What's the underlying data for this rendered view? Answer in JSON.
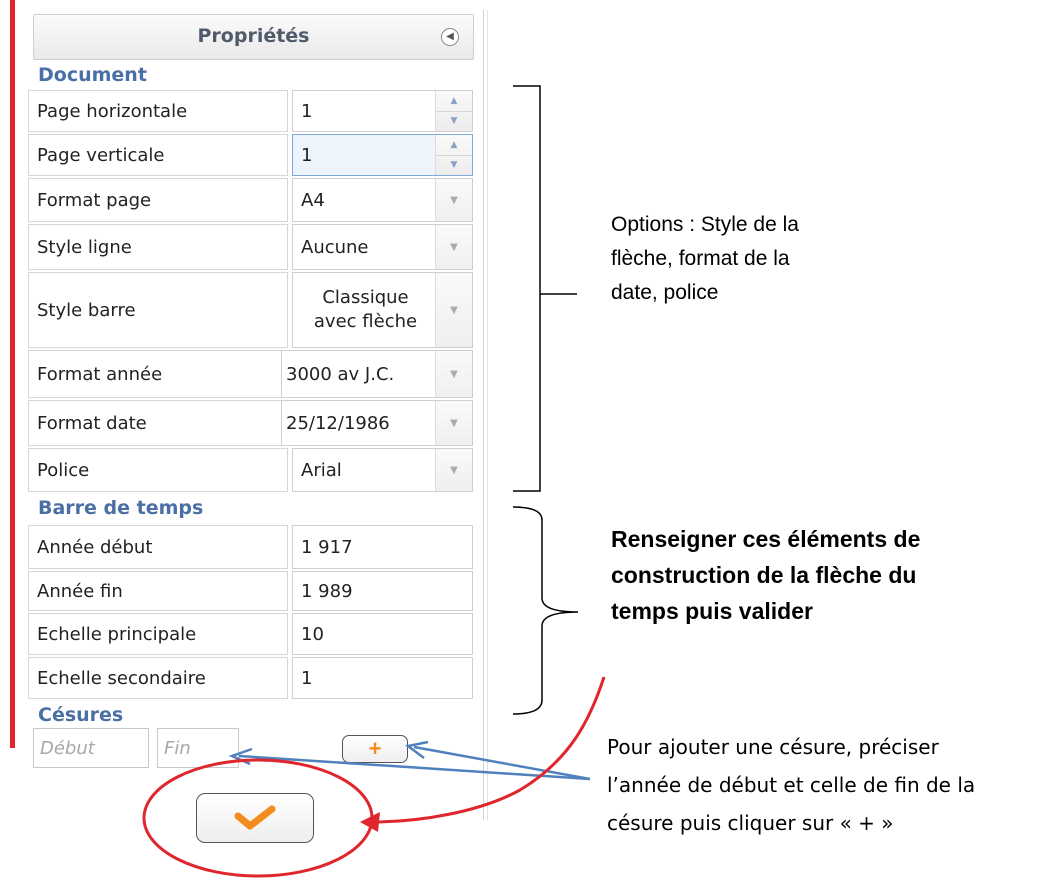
{
  "panel": {
    "title": "Propriétés",
    "collapse_icon": "circle-left-arrow-icon"
  },
  "document": {
    "title": "Document",
    "rows": [
      {
        "label": "Page horizontale",
        "value": "1",
        "control": "spinner"
      },
      {
        "label": "Page verticale",
        "value": "1",
        "control": "spinner"
      },
      {
        "label": "Format page",
        "value": "A4",
        "control": "dropdown"
      },
      {
        "label": "Style ligne",
        "value": "Aucune",
        "control": "dropdown"
      },
      {
        "label": "Style barre",
        "value": "Classique avec flèche",
        "value_line1": "Classique",
        "value_line2": "avec flèche",
        "control": "dropdown"
      },
      {
        "label": "Format année",
        "value": "3000 av J.C.",
        "control": "dropdown"
      },
      {
        "label": "Format date",
        "value": "25/12/1986",
        "control": "dropdown"
      },
      {
        "label": "Police",
        "value": "Arial",
        "control": "dropdown"
      }
    ]
  },
  "barre_de_temps": {
    "title": "Barre de temps",
    "rows": [
      {
        "label": "Année début",
        "value": "1 917"
      },
      {
        "label": "Année fin",
        "value": "1 989"
      },
      {
        "label": "Echelle principale",
        "value": "10"
      },
      {
        "label": "Echelle secondaire",
        "value": "1"
      }
    ]
  },
  "cesures": {
    "title": "Césures",
    "debut_placeholder": "Début",
    "fin_placeholder": "Fin",
    "add_button": "+"
  },
  "validate_button_icon": "checkmark-icon",
  "annotations": {
    "options": "Options : Style de la flèche, format de la date, police",
    "options_lines": [
      "Options : Style de la",
      "flèche, format de la",
      "date, police"
    ],
    "renseigner": "Renseigner  ces éléments de construction de la flèche du temps puis valider",
    "renseigner_lines": [
      "Renseigner  ces éléments de",
      "construction de la flèche du",
      "temps puis valider"
    ],
    "cesure": "Pour ajouter une césure, préciser l’année de début et celle de fin de la césure puis cliquer sur « + »",
    "cesure_lines": [
      "Pour ajouter une césure, préciser",
      "l’année de début et celle de fin de la",
      "césure puis cliquer sur « + »"
    ]
  },
  "colors": {
    "section_title": "#4a6fa5",
    "red_annotation": "#e0262d",
    "blue_arrow": "#4f81bd",
    "check_orange": "#f28c1c"
  }
}
